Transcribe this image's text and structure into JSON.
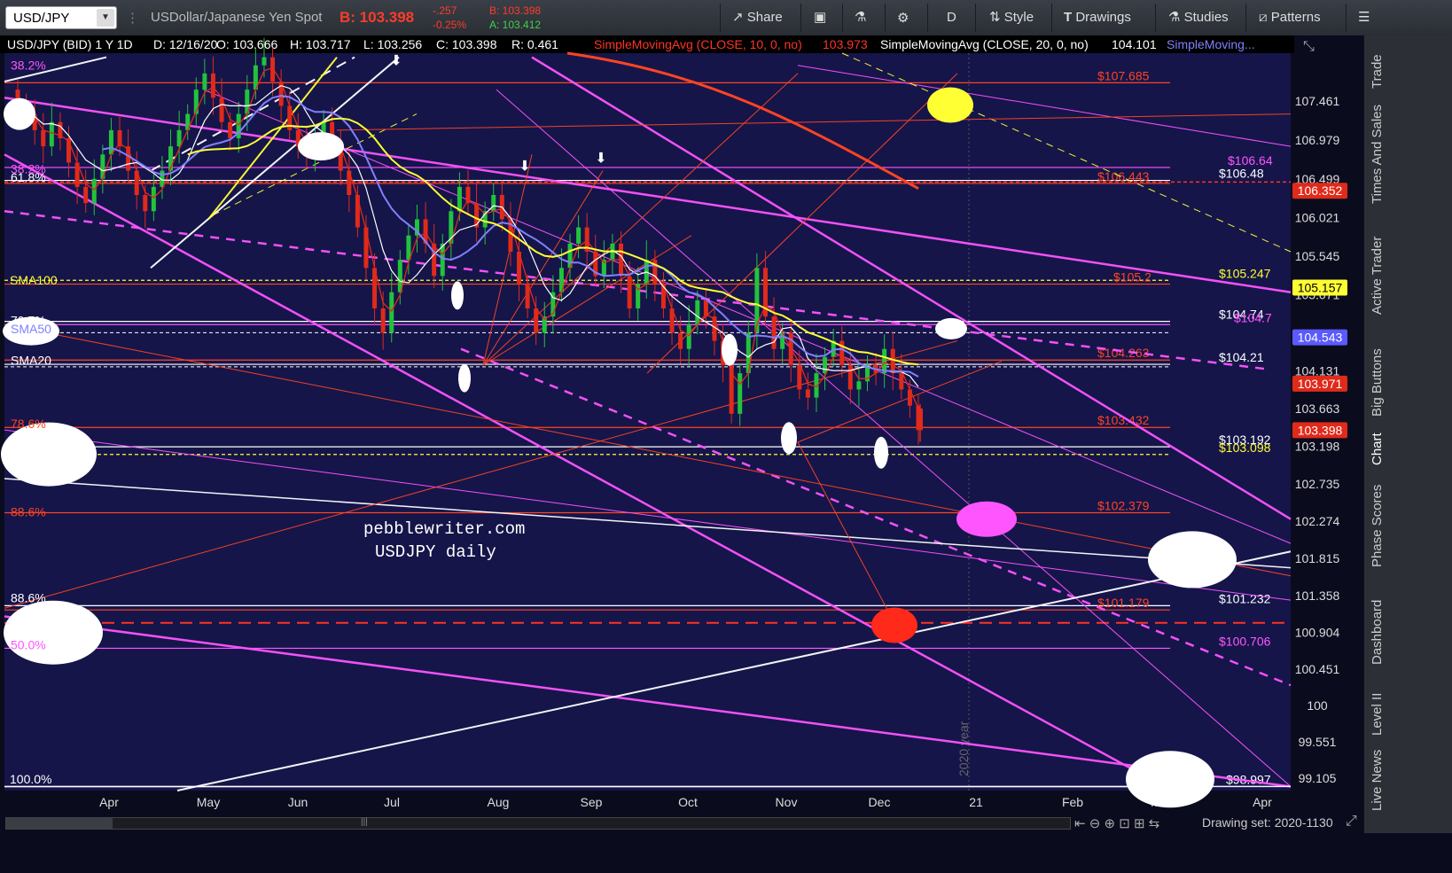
{
  "toolbar": {
    "symbol": "USD/JPY",
    "description": "USDollar/Japanese Yen Spot",
    "bid_label": "B: 103.398",
    "change": "-.257",
    "change_pct": "-0.25%",
    "bid_small": "B: 103.398",
    "ask_small": "A: 103.412",
    "share": "Share",
    "period": "D",
    "style": "Style",
    "drawings": "Drawings",
    "studies": "Studies",
    "patterns": "Patterns"
  },
  "header": {
    "info": "USD/JPY (BID) 1 Y 1D",
    "date": "D: 12/16/20",
    "open": "O: 103.666",
    "high": "H: 103.717",
    "low": "L: 103.256",
    "close": "C: 103.398",
    "range": "R: 0.461",
    "sma10": "SimpleMovingAvg (CLOSE, 10, 0, no)",
    "sma10_val": "103.973",
    "sma20": "SimpleMovingAvg (CLOSE, 20, 0, no)",
    "sma20_val": "104.101",
    "sma_more": "SimpleMoving..."
  },
  "side_tabs": [
    "Trade",
    "Times And Sales",
    "Active Trader",
    "Big Buttons",
    "Chart",
    "Phase Scores",
    "Dashboard",
    "Level II",
    "Live News"
  ],
  "footer": {
    "drawing_set": "Drawing set: 2020-1130"
  },
  "watermark": {
    "line1": "pebblewriter.com",
    "line2": "USDJPY daily"
  },
  "colors": {
    "background": "#15154a",
    "panel": "#0b0b1e",
    "up": "#22c33c",
    "down": "#e02a1a",
    "sma10": "#e02a1a",
    "sma20": "#ffffff",
    "sma50": "#8080ff",
    "sma100": "#ffff33",
    "sma200": "#ff4422",
    "fib": "#ff55ff"
  },
  "chart_data": {
    "type": "candlestick",
    "symbol": "USD/JPY",
    "timeframe": "1 Y 1D",
    "x_ticks": [
      "Apr",
      "May",
      "Jun",
      "Jul",
      "Aug",
      "Sep",
      "Oct",
      "Nov",
      "Dec",
      "21",
      "Feb",
      "Mar",
      "Apr"
    ],
    "y_ticks": [
      "107.461",
      "106.979",
      "106.499",
      "106.021",
      "105.545",
      "105.071",
      "104.131",
      "103.663",
      "103.198",
      "102.735",
      "102.274",
      "101.815",
      "101.358",
      "100.904",
      "100.451",
      "100",
      "99.551",
      "99.105"
    ],
    "ylim": [
      98.95,
      108.05
    ],
    "last_bar": {
      "date": "12/16/20",
      "open": 103.666,
      "high": 103.717,
      "low": 103.256,
      "close": 103.398
    },
    "closes": [
      107.4,
      107.3,
      107.1,
      106.9,
      107.2,
      107.0,
      106.7,
      106.4,
      106.2,
      106.5,
      106.8,
      107.1,
      106.9,
      106.6,
      106.3,
      106.1,
      106.4,
      106.6,
      106.9,
      107.1,
      107.3,
      107.6,
      107.8,
      107.5,
      107.2,
      107.0,
      107.3,
      107.6,
      107.9,
      108.0,
      107.7,
      107.4,
      107.1,
      106.9,
      106.8,
      107.0,
      107.2,
      106.9,
      106.6,
      106.3,
      105.9,
      105.4,
      104.9,
      104.6,
      105.1,
      105.5,
      105.8,
      106.0,
      105.7,
      105.3,
      105.7,
      106.1,
      106.4,
      106.2,
      105.9,
      106.1,
      106.3,
      106.0,
      105.6,
      105.2,
      104.9,
      104.6,
      104.8,
      105.1,
      105.4,
      105.7,
      105.9,
      105.6,
      105.3,
      105.5,
      105.7,
      105.3,
      104.9,
      105.2,
      105.5,
      105.2,
      104.9,
      104.6,
      104.4,
      104.7,
      105.0,
      104.8,
      104.5,
      104.2,
      103.6,
      104.1,
      104.6,
      105.4,
      104.8,
      104.4,
      104.6,
      104.2,
      103.9,
      103.8,
      104.1,
      104.3,
      104.5,
      104.2,
      103.9,
      104.0,
      104.2,
      104.1,
      104.4,
      104.1,
      103.9,
      103.7,
      103.4
    ],
    "price_levels": [
      {
        "label": "$107.685",
        "value": 107.685,
        "color": "#ff4422"
      },
      {
        "label": "$106.64",
        "value": 106.64,
        "color": "#ff55ff"
      },
      {
        "label": "$106.48",
        "value": 106.48,
        "color": "#ffffff"
      },
      {
        "label": "$106.443",
        "value": 106.443,
        "color": "#ff4422"
      },
      {
        "label": "$105.2",
        "value": 105.2,
        "color": "#ff4422"
      },
      {
        "label": "$105.247",
        "value": 105.247,
        "color": "#ffff33"
      },
      {
        "label": "$104.74",
        "value": 104.74,
        "color": "#ffffff"
      },
      {
        "label": "$104.7",
        "value": 104.7,
        "color": "#ff55ff"
      },
      {
        "label": "$104.263",
        "value": 104.263,
        "color": "#ff4422"
      },
      {
        "label": "$104.21",
        "value": 104.21,
        "color": "#ffffff"
      },
      {
        "label": "$103.432",
        "value": 103.432,
        "color": "#ff4422"
      },
      {
        "label": "$103.192",
        "value": 103.192,
        "color": "#ffffff"
      },
      {
        "label": "$103.098",
        "value": 103.098,
        "color": "#ffff33"
      },
      {
        "label": "$102.379",
        "value": 102.379,
        "color": "#ff4422"
      },
      {
        "label": "$101.232",
        "value": 101.232,
        "color": "#ffffff"
      },
      {
        "label": "$101.179",
        "value": 101.179,
        "color": "#ff4422"
      },
      {
        "label": "$100.706",
        "value": 100.706,
        "color": "#ff55ff"
      },
      {
        "label": "$98.997",
        "value": 98.997,
        "color": "#ffffff"
      }
    ],
    "price_bubbles": [
      {
        "label": "106.352",
        "value": 106.352,
        "bg": "#e02a1a",
        "fg": "#ffffff"
      },
      {
        "label": "105.157",
        "value": 105.157,
        "bg": "#ffff33",
        "fg": "#000000"
      },
      {
        "label": "104.543",
        "value": 104.543,
        "bg": "#5a5aff",
        "fg": "#ffffff"
      },
      {
        "label": "103.971",
        "value": 103.971,
        "bg": "#e02a1a",
        "fg": "#ffffff"
      },
      {
        "label": "103.398",
        "value": 103.398,
        "bg": "#e02a1a",
        "fg": "#ffffff"
      }
    ],
    "left_labels": [
      {
        "label": "38.2%",
        "value": 107.9,
        "color": "#ff55ff"
      },
      {
        "label": "38.2%",
        "value": 106.62,
        "color": "#ff55ff"
      },
      {
        "label": "61.8%",
        "value": 106.52,
        "color": "#ffffff"
      },
      {
        "label": "SMA100",
        "value": 105.25,
        "color": "#ffff33"
      },
      {
        "label": "70.7%",
        "value": 104.75,
        "color": "#ffffff"
      },
      {
        "label": "SMA50",
        "value": 104.65,
        "color": "#8080ff"
      },
      {
        "label": "SMA20",
        "value": 104.26,
        "color": "#ffffff"
      },
      {
        "label": "78.6%",
        "value": 103.48,
        "color": "#ff4422"
      },
      {
        "label": "88.6%",
        "value": 102.39,
        "color": "#ff4422"
      },
      {
        "label": "88.6%",
        "value": 101.33,
        "color": "#ffffff"
      },
      {
        "label": "50.0%",
        "value": 100.75,
        "color": "#ff55ff"
      },
      {
        "label": "100.0%",
        "value": 99.09,
        "color": "#ffffff"
      }
    ],
    "year_label": "2020 year"
  }
}
